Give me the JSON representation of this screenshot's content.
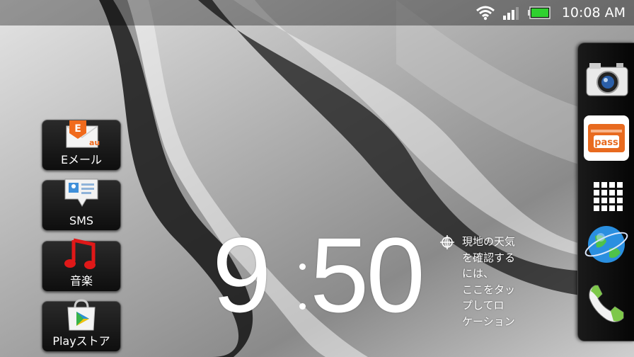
{
  "status_bar": {
    "time": "10:08 AM",
    "icons": [
      "wifi-icon",
      "signal-icon",
      "battery-icon"
    ],
    "battery_color": "#2fd12f"
  },
  "apps": [
    {
      "label": "Eメール",
      "icon": "email-icon",
      "badge": "E",
      "sub": "au"
    },
    {
      "label": "SMS",
      "icon": "sms-icon"
    },
    {
      "label": "音楽",
      "icon": "music-icon"
    },
    {
      "label": "Playストア",
      "icon": "playstore-icon"
    }
  ],
  "clock": {
    "hours": "9",
    "minutes": "50"
  },
  "weather": {
    "lines": [
      "現地の天気",
      "を確認する",
      "には、",
      "ここをタッ",
      "プしてロ",
      "ケーション"
    ]
  },
  "dock": {
    "items": [
      "camera-icon",
      "pass-icon",
      "app-drawer-icon",
      "browser-icon",
      "phone-icon"
    ],
    "pass_label": "pass",
    "accent": "#e86a1f"
  }
}
